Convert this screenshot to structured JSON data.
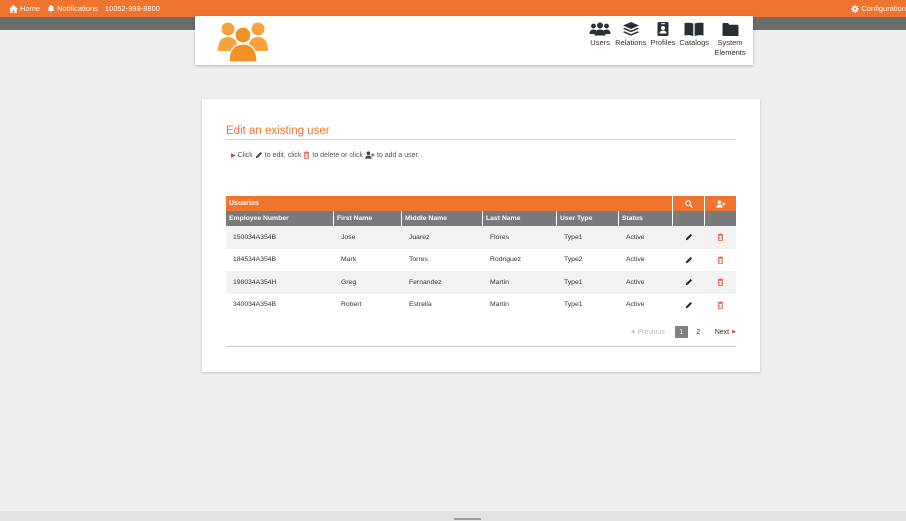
{
  "topbar": {
    "home_label": "Home",
    "notifications_label": "Notifications",
    "phone": "10052-998-8800",
    "configuration_label": "Configuration"
  },
  "header": {
    "nav": [
      {
        "label": "Users",
        "icon": "users-icon"
      },
      {
        "label": "Relations",
        "icon": "layers-icon"
      },
      {
        "label": "Profiles",
        "icon": "id-badge-icon"
      },
      {
        "label": "Catalogs",
        "icon": "book-icon"
      },
      {
        "label": "System Elements",
        "icon": "folder-icon"
      }
    ]
  },
  "main": {
    "title": "Edit an existing user",
    "hint": {
      "part1": "Click",
      "part2": "to edit, click",
      "part3": "to delete or click",
      "part4": "to add a user."
    },
    "table": {
      "caption": "Usuarios",
      "columns": [
        "Employee Number",
        "First Name",
        "Middle Name",
        "Last Name",
        "User Type",
        "Status"
      ],
      "rows": [
        [
          "150034A354B",
          "Jose",
          "Juarez",
          "Flores",
          "Type1",
          "Active"
        ],
        [
          "184534A354B",
          "Mark",
          "Torres",
          "Rodriguez",
          "Type2",
          "Active"
        ],
        [
          "198034A354H",
          "Greg",
          "Fernandez",
          "Martin",
          "Type1",
          "Active"
        ],
        [
          "340034A354B",
          "Robert",
          "Estrella",
          "Martin",
          "Type1",
          "Active"
        ]
      ]
    },
    "pagination": {
      "previous": "Previous",
      "pages": [
        "1",
        "2"
      ],
      "current": "1",
      "next": "Next"
    }
  },
  "colors": {
    "accent": "#ee7430",
    "header_grey": "#7a7a7a",
    "delete_red": "#e05a3a"
  }
}
